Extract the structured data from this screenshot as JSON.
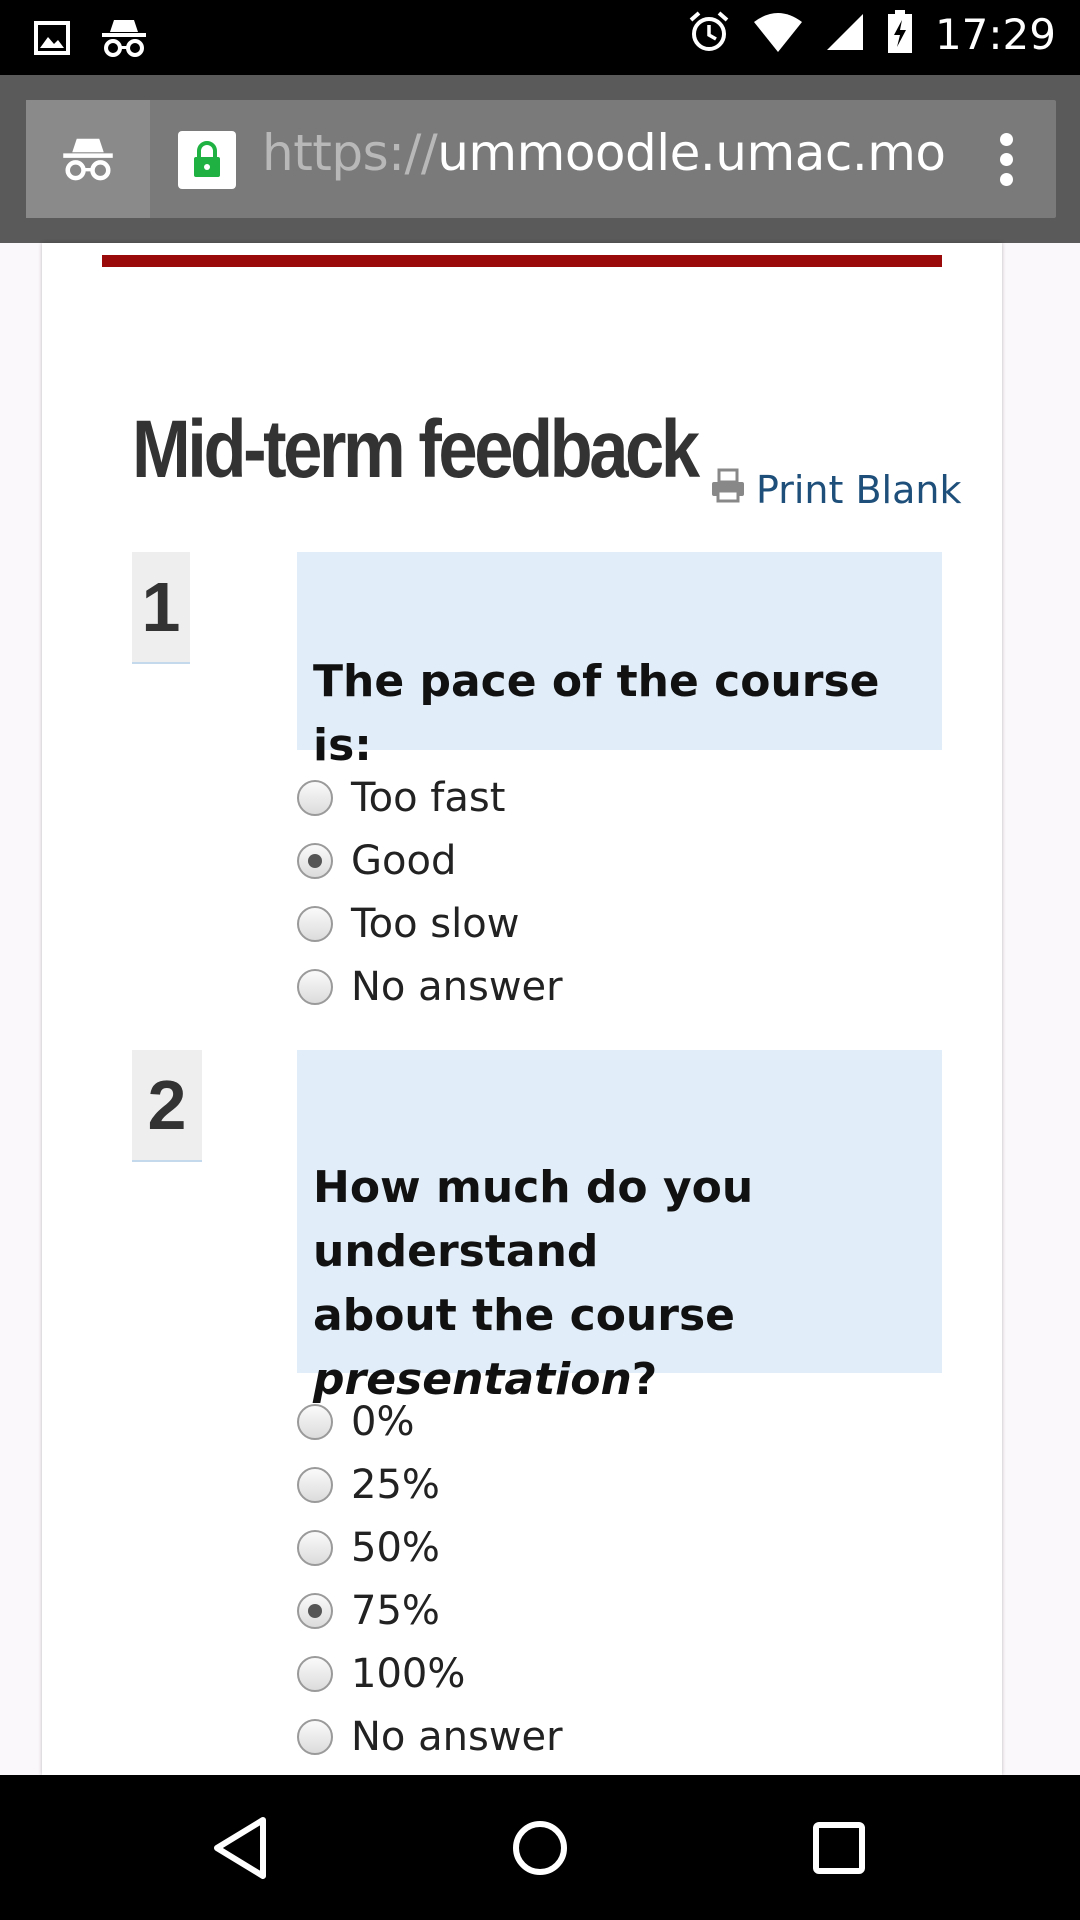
{
  "status_bar": {
    "time": "17:29",
    "left_icons": [
      "image-icon",
      "incognito-icon"
    ],
    "right_icons": [
      "alarm-icon",
      "wifi-icon",
      "signal-icon",
      "battery-charging-icon"
    ]
  },
  "browser": {
    "url_scheme": "https://",
    "url_host": "ummoodle.umac.mo",
    "icons": [
      "incognito-icon",
      "lock-icon",
      "more-vert-icon"
    ],
    "lock_color": "#1fb141"
  },
  "page": {
    "accent_color": "#9a0a0a",
    "title": "Mid-term feedback",
    "print_label": "Print Blank",
    "questions": [
      {
        "number": "1",
        "text_parts": [
          "The pace of the course is:"
        ],
        "options": [
          {
            "label": "Too fast",
            "checked": false
          },
          {
            "label": "Good",
            "checked": true
          },
          {
            "label": "Too slow",
            "checked": false
          },
          {
            "label": "No answer",
            "checked": false
          }
        ]
      },
      {
        "number": "2",
        "text_line1": "How much do you understand",
        "text_line2": "about the course",
        "text_italic": "presentation",
        "text_suffix": "?",
        "options": [
          {
            "label": "0%",
            "checked": false
          },
          {
            "label": "25%",
            "checked": false
          },
          {
            "label": "50%",
            "checked": false
          },
          {
            "label": "75%",
            "checked": true
          },
          {
            "label": "100%",
            "checked": false
          },
          {
            "label": "No answer",
            "checked": false
          }
        ]
      }
    ]
  },
  "nav_bar": {
    "icons": [
      "back-icon",
      "home-icon",
      "recents-icon"
    ]
  }
}
